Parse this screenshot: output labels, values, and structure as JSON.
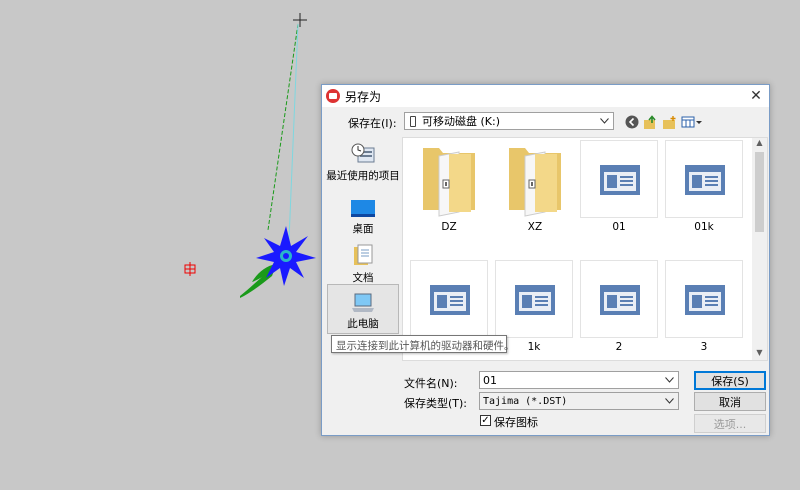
{
  "dialog": {
    "title": "另存为",
    "close_glyph": "✕",
    "save_in_label": "保存在(I):",
    "save_in_value": "可移动磁盘 (K:)",
    "places": [
      {
        "label": "最近使用的项目",
        "icon": "recent-items-icon"
      },
      {
        "label": "桌面",
        "icon": "desktop-icon"
      },
      {
        "label": "文档",
        "icon": "documents-icon"
      },
      {
        "label": "此电脑",
        "icon": "this-pc-icon",
        "selected": true
      }
    ],
    "files": [
      {
        "name": "DZ",
        "type": "folder"
      },
      {
        "name": "XZ",
        "type": "folder"
      },
      {
        "name": "01",
        "type": "file"
      },
      {
        "name": "01k",
        "type": "file"
      },
      {
        "name": "",
        "type": "file"
      },
      {
        "name": "1k",
        "type": "file"
      },
      {
        "name": "2",
        "type": "file"
      },
      {
        "name": "3",
        "type": "file"
      }
    ],
    "tooltip": "显示连接到此计算机的驱动器和硬件。",
    "filename_label": "文件名(N):",
    "filename_value": "01",
    "filetype_label": "保存类型(T):",
    "filetype_value": "Tajima (*.DST)",
    "save_button": "保存(S)",
    "cancel_button": "取消",
    "options_button": "选项...",
    "save_icon_checkbox_label": "保存图标",
    "save_icon_checked": true
  },
  "colors": {
    "canvas_bg": "#c8c8c8",
    "flower_blue": "#1a1aff",
    "leaf_green": "#1a9a1a",
    "accent": "#0078d7"
  }
}
